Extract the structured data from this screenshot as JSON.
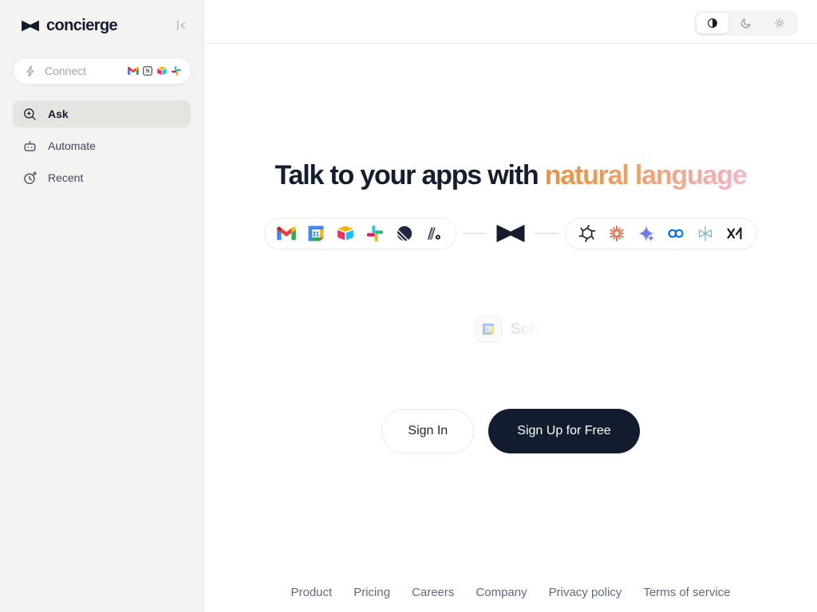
{
  "app_title": "concierge",
  "colors": {
    "dark_navy": "#131C2E",
    "accent_orange": "#E8923F",
    "accent_pink": "#F5B4CB",
    "sidebar_bg": "#F4F3F1"
  },
  "sidebar": {
    "logo_text": "concierge",
    "connect": {
      "label": "Connect",
      "service_icons": [
        "Gmail",
        "Notion",
        "Airtable",
        "Slack"
      ]
    },
    "items": [
      {
        "label": "Ask",
        "icon": "search-sparkle",
        "active": true
      },
      {
        "label": "Automate",
        "icon": "robot",
        "active": false
      },
      {
        "label": "Recent",
        "icon": "history-clock",
        "active": false
      }
    ]
  },
  "header": {
    "theme_switcher": {
      "options": [
        "contrast",
        "dark",
        "light"
      ],
      "active": "contrast"
    }
  },
  "hero": {
    "title_prefix": "Talk to your apps with ",
    "title_gradient": "natural language",
    "left_apps": [
      "Gmail",
      "Google Calendar",
      "Airtable",
      "Slack",
      "Linear",
      "Attio"
    ],
    "right_apps": [
      "OpenAI",
      "Claude",
      "Gemini",
      "Meta",
      "Perplexity",
      "xAI"
    ],
    "ghost_prompt": "Sche"
  },
  "cta": {
    "sign_in": "Sign In",
    "sign_up": "Sign Up for Free"
  },
  "footer": {
    "links": [
      "Product",
      "Pricing",
      "Careers",
      "Company",
      "Privacy policy",
      "Terms of service"
    ]
  }
}
